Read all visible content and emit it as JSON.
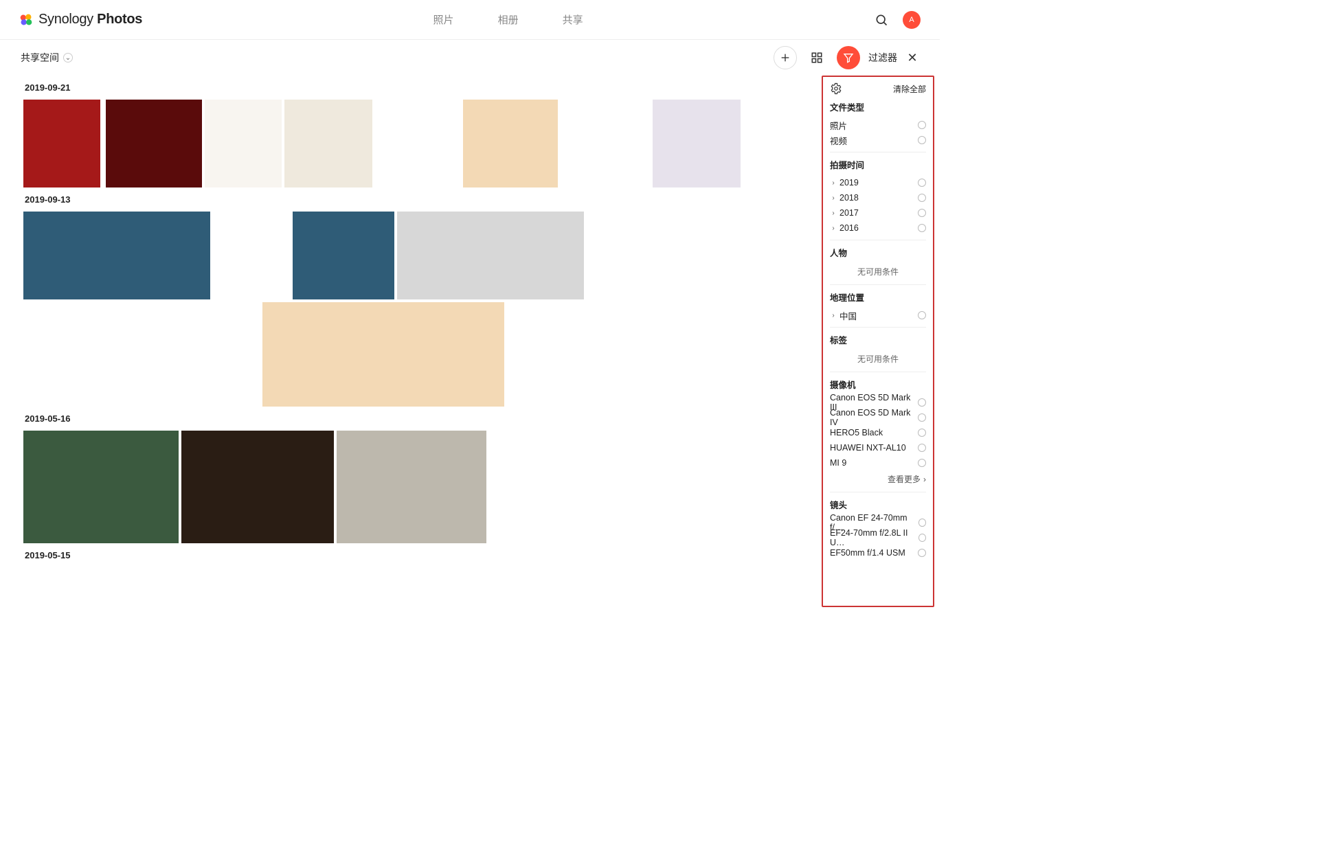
{
  "brand": {
    "name_plain": "Synology",
    "name_bold": "Photos"
  },
  "tabs": [
    "照片",
    "相册",
    "共享"
  ],
  "avatar_letter": "A",
  "toolbar": {
    "space": "共享空间",
    "filter_label": "过滤器"
  },
  "groups": [
    {
      "date": "2019-09-21",
      "count": 8
    },
    {
      "date": "2019-09-13",
      "count": 8
    },
    {
      "date": "2019-05-16",
      "count": 3
    },
    {
      "date": "2019-05-15",
      "count": 0
    }
  ],
  "filter": {
    "clear_all": "清除全部",
    "sections": {
      "file_type": {
        "title": "文件类型",
        "items": [
          "照片",
          "视频"
        ]
      },
      "date": {
        "title": "拍摄时间",
        "items": [
          "2019",
          "2018",
          "2017",
          "2016"
        ]
      },
      "people": {
        "title": "人物",
        "empty": "无可用条件"
      },
      "geo": {
        "title": "地理位置",
        "items": [
          "中国"
        ]
      },
      "tags": {
        "title": "标签",
        "empty": "无可用条件"
      },
      "camera": {
        "title": "摄像机",
        "items": [
          "Canon EOS 5D Mark III",
          "Canon EOS 5D Mark IV",
          "HERO5 Black",
          "HUAWEI NXT-AL10",
          "MI 9"
        ],
        "more": "查看更多"
      },
      "lens": {
        "title": "镜头",
        "items": [
          "Canon EF 24-70mm f/…",
          "EF24-70mm f/2.8L II U…",
          "EF50mm f/1.4 USM"
        ]
      }
    }
  }
}
